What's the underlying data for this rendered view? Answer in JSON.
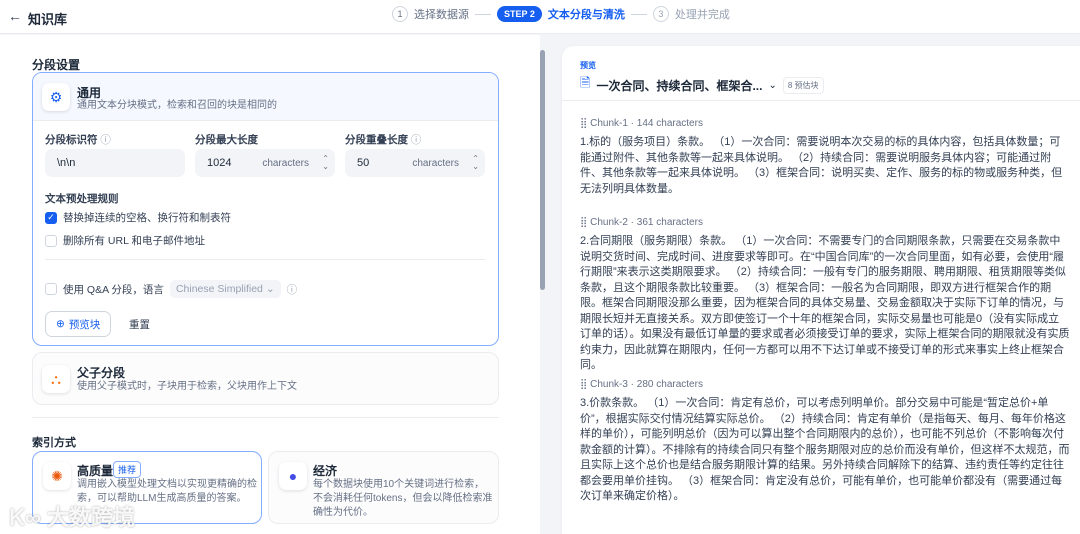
{
  "header": {
    "back_icon": "arrow-left-icon",
    "title": "知识库",
    "steps": [
      {
        "num": "1",
        "label": "选择数据源"
      },
      {
        "badge": "STEP 2",
        "label": "文本分段与清洗"
      },
      {
        "num": "3",
        "label": "处理并完成"
      }
    ]
  },
  "segment": {
    "heading": "分段设置",
    "general": {
      "title": "通用",
      "desc": "通用文本分块模式，检索和召回的块是相同的",
      "fields": [
        {
          "label": "分段标识符",
          "value": "\\n\\n"
        },
        {
          "label": "分段最大长度",
          "value": "1024",
          "unit": "characters"
        },
        {
          "label": "分段重叠长度",
          "value": "50",
          "unit": "characters"
        }
      ],
      "rules_heading": "文本预处理规则",
      "rules": [
        {
          "label": "替换掉连续的空格、换行符和制表符",
          "checked": true
        },
        {
          "label": "删除所有 URL 和电子邮件地址",
          "checked": false
        }
      ],
      "qa_label": "使用 Q&A 分段，语言",
      "qa_language": "Chinese Simplified",
      "preview_button": "预览块",
      "reset_button": "重置"
    },
    "parent_child": {
      "title": "父子分段",
      "desc": "使用父子模式时，子块用于检索，父块用作上下文"
    }
  },
  "index": {
    "heading": "索引方式",
    "high": {
      "title": "高质量",
      "badge": "推荐",
      "desc": "调用嵌入模型处理文档以实现更精确的检索，可以帮助LLM生成高质量的答案。"
    },
    "economy": {
      "title": "经济",
      "desc": "每个数据块使用10个关键词进行检索，不会消耗任何tokens，但会以降低检索准确性为代价。"
    }
  },
  "preview": {
    "label": "预览",
    "doc_title": "一次合同、持续合同、框架合...",
    "chunk_count": "8 预估块",
    "chunks": [
      {
        "name": "Chunk-1 · 144 characters",
        "text": "1.标的（服务项目）条款。 （1）一次合同：需要说明本次交易的标的具体内容，包括具体数量；可能通过附件、其他条款等一起来具体说明。 （2）持续合同：需要说明服务具体内容；可能通过附件、其他条款等一起来具体说明。 （3）框架合同：说明买卖、定作、服务的标的物或服务种类，但无法列明具体数量。"
      },
      {
        "name": "Chunk-2 · 361 characters",
        "text": "2.合同期限（服务期限）条款。 （1）一次合同：不需要专门的合同期限条款，只需要在交易条款中说明交货时间、完成时间、进度要求等即可。在“中国合同库”的一次合同里面，如有必要，会使用“履行期限”来表示这类期限要求。 （2）持续合同：一般有专门的服务期限、聘用期限、租赁期限等类似条款，且这个期限条款比较重要。 （3）框架合同：一般名为合同期限，即双方进行框架合作的期限。框架合同期限没那么重要，因为框架合同的具体交易量、交易金额取决于实际下订单的情况，与期限长短并无直接关系。双方即使签订一个十年的框架合同，实际交易量也可能是0（没有实际成立订单的话）。如果没有最低订单量的要求或者必须接受订单的要求，实际上框架合同的期限就没有实质约束力，因此就算在期限内，任何一方都可以用不下达订单或不接受订单的形式来事实上终止框架合同。"
      },
      {
        "name": "Chunk-3 · 280 characters",
        "text": "3.价款条款。 （1）一次合同：肯定有总价，可以考虑列明单价。部分交易中可能是“暂定总价+单价”，根据实际交付情况结算实际总价。 （2）持续合同：肯定有单价（是指每天、每月、每年价格这样的单价），可能列明总价（因为可以算出整个合同期限内的总价），也可能不列总价（不影响每次付款金额的计算）。不排除有的持续合同只有整个服务期限对应的总价而没有单价，但这样不太规范，而且实际上这个总价也是结合服务期限计算的结果。另外持续合同解除下的结算、违约责任等约定往往都会要用单价挂钩。 （3）框架合同：肯定没有总价，可能有单价，也可能单价都没有（需要通过每次订单来确定价格）。"
      }
    ]
  },
  "watermark": "大数跨境"
}
